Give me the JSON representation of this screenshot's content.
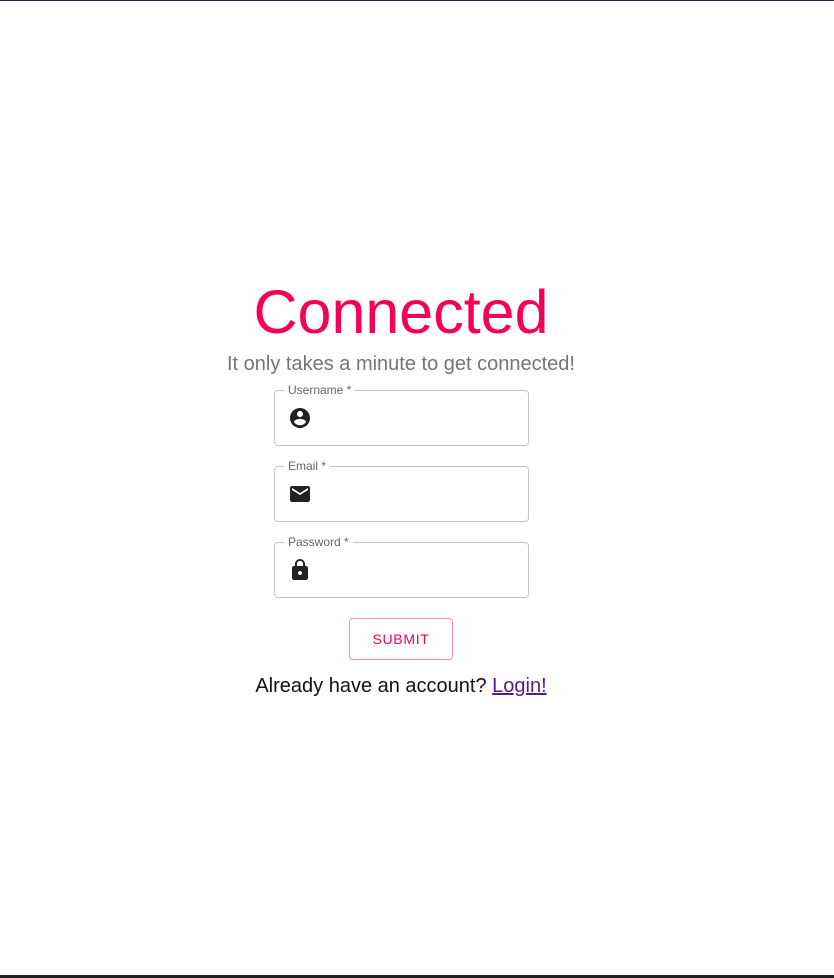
{
  "header": {
    "title": "Connected",
    "subtitle": "It only takes a minute to get connected!"
  },
  "form": {
    "fields": [
      {
        "label": "Username *",
        "value": "",
        "placeholder": "",
        "icon": "account-circle-icon"
      },
      {
        "label": "Email *",
        "value": "",
        "placeholder": "",
        "icon": "mail-icon"
      },
      {
        "label": "Password *",
        "value": "",
        "placeholder": "",
        "icon": "lock-icon"
      }
    ],
    "submit_label": "SUBMIT"
  },
  "footer": {
    "prompt": "Already have an account? ",
    "link_label": "Login!"
  },
  "colors": {
    "accent": "#f50057",
    "subtitle": "#757575",
    "field_border": "#c4c4c4",
    "link": "#551a8b"
  }
}
